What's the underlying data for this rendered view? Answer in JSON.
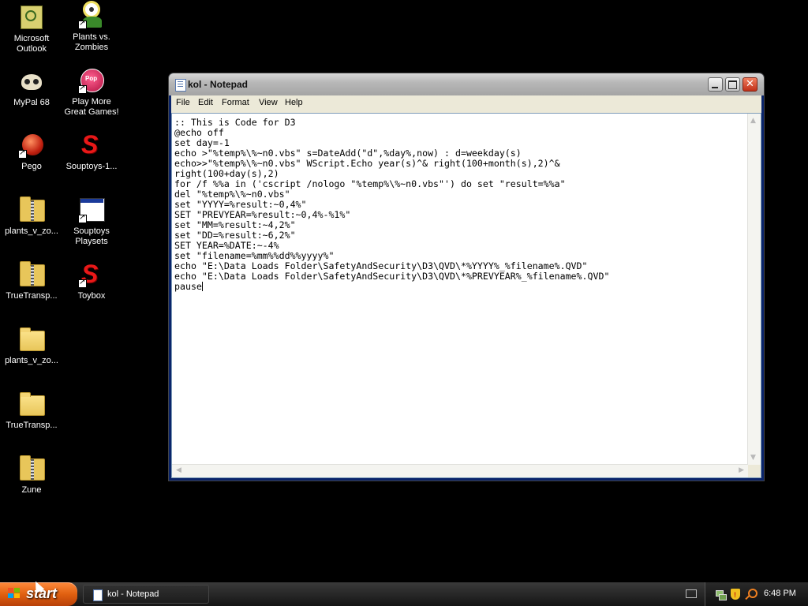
{
  "desktop": {
    "icons": [
      {
        "label": "Microsoft Outlook",
        "line1": "Microsoft",
        "line2": "Outlook",
        "icon": "outlook-icon"
      },
      {
        "label": "Plants vs. Zombies",
        "line1": "Plants vs.",
        "line2": "Zombies",
        "icon": "plants-vs-zombies-icon"
      },
      {
        "label": "MyPal 68",
        "icon": "mypal-icon"
      },
      {
        "label": "Play More Great Games!",
        "line1": "Play More",
        "line2": "Great Games!",
        "icon": "popcap-icon"
      },
      {
        "label": "Pego",
        "icon": "pego-icon"
      },
      {
        "label": "Souptoys-1...",
        "icon": "souptoys-icon"
      },
      {
        "label": "plants_v_zo...",
        "icon": "zip-folder-icon"
      },
      {
        "label": "Souptoys Playsets",
        "line1": "Souptoys",
        "line2": "Playsets",
        "icon": "window-app-icon"
      },
      {
        "label": "TrueTransp...",
        "icon": "zip-folder-icon"
      },
      {
        "label": "Toybox",
        "icon": "souptoys-icon"
      },
      {
        "label": "plants_v_zo...",
        "icon": "folder-icon"
      },
      {
        "label": "TrueTransp...",
        "icon": "folder-icon"
      },
      {
        "label": "Zune",
        "icon": "zip-folder-icon"
      }
    ]
  },
  "window": {
    "title": "kol - Notepad",
    "menu": [
      "File",
      "Edit",
      "Format",
      "View",
      "Help"
    ],
    "content": ":: This is Code for D3\n@echo off\nset day=-1\necho >\"%temp%\\%~n0.vbs\" s=DateAdd(\"d\",%day%,now) : d=weekday(s)\necho>>\"%temp%\\%~n0.vbs\" WScript.Echo year(s)^& right(100+month(s),2)^&\nright(100+day(s),2)\nfor /f %%a in ('cscript /nologo \"%temp%\\%~n0.vbs\"') do set \"result=%%a\"\ndel \"%temp%\\%~n0.vbs\"\nset \"YYYY=%result:~0,4%\"\nSET \"PREVYEAR=%result:~0,4%-%1%\"\nset \"MM=%result:~4,2%\"\nset \"DD=%result:~6,2%\"\nSET YEAR=%DATE:~-4%\nset \"filename=%mm%%dd%%yyyy%\"\necho \"E:\\Data Loads Folder\\SafetyAndSecurity\\D3\\QVD\\*%YYYY%_%filename%.QVD\"\necho \"E:\\Data Loads Folder\\SafetyAndSecurity\\D3\\QVD\\*%PREVYEAR%_%filename%.QVD\"\npause"
  },
  "taskbar": {
    "start_label": "start",
    "tasks": [
      {
        "label": "kol - Notepad"
      }
    ],
    "clock": "6:48 PM"
  }
}
